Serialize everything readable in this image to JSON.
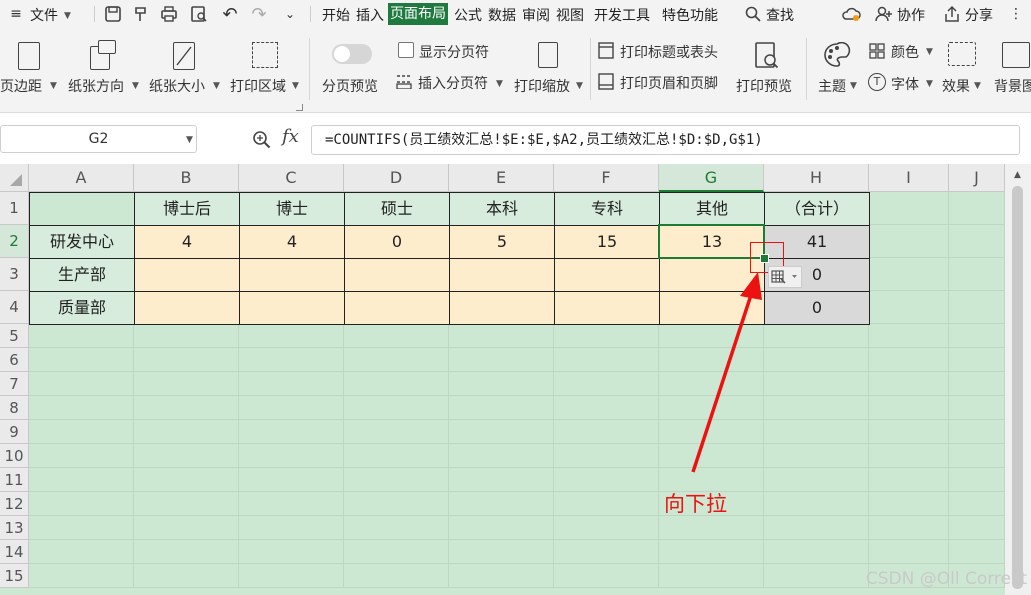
{
  "menubar": {
    "file_label": "文件",
    "tabs": [
      "开始",
      "插入",
      "页面布局",
      "公式",
      "数据",
      "审阅",
      "视图",
      "开发工具",
      "特色功能"
    ],
    "active_tab": "页面布局",
    "search_label": "查找",
    "collab_label": "协作",
    "share_label": "分享"
  },
  "ribbon": {
    "margins": "页边距",
    "orientation": "纸张方向",
    "size": "纸张大小",
    "print_area": "打印区域",
    "page_break_preview": "分页预览",
    "show_page_break": "显示分页符",
    "insert_page_break": "插入分页符",
    "print_scale": "打印缩放",
    "print_titles": "打印标题或表头",
    "print_header_footer": "打印页眉和页脚",
    "print_preview": "打印预览",
    "theme": "主题",
    "colors": "颜色",
    "fonts": "字体",
    "effects": "效果",
    "background": "背景图"
  },
  "formula_bar": {
    "name_box": "G2",
    "fx": "fx",
    "formula": "=COUNTIFS(员工绩效汇总!$E:$E,$A2,员工绩效汇总!$D:$D,G$1)"
  },
  "grid": {
    "columns": [
      "A",
      "B",
      "C",
      "D",
      "E",
      "F",
      "G",
      "H",
      "I",
      "J"
    ],
    "rows": [
      "1",
      "2",
      "3",
      "4",
      "5",
      "6",
      "7",
      "8",
      "9",
      "10",
      "11",
      "12",
      "13",
      "14",
      "15"
    ],
    "header_row": [
      "",
      "博士后",
      "博士",
      "硕士",
      "本科",
      "专科",
      "其他",
      "（合计）"
    ],
    "data_rows": [
      {
        "label": "研发中心",
        "values": [
          "4",
          "4",
          "0",
          "5",
          "15",
          "13",
          "41"
        ]
      },
      {
        "label": "生产部",
        "values": [
          "",
          "",
          "",
          "",
          "",
          "",
          "0"
        ]
      },
      {
        "label": "质量部",
        "values": [
          "",
          "",
          "",
          "",
          "",
          "",
          "0"
        ]
      }
    ],
    "selected_cell": "G2"
  },
  "annotation": "向下拉",
  "watermark": "CSDN @Oll Correct",
  "colors": {
    "active_tab": "#1f7a3f",
    "header_fill": "#d7ecdd",
    "data_fill": "#fdedcc",
    "total_fill": "#d9d9d9",
    "sheet_bg": "#cde8d2",
    "arrow": "#e11111"
  }
}
